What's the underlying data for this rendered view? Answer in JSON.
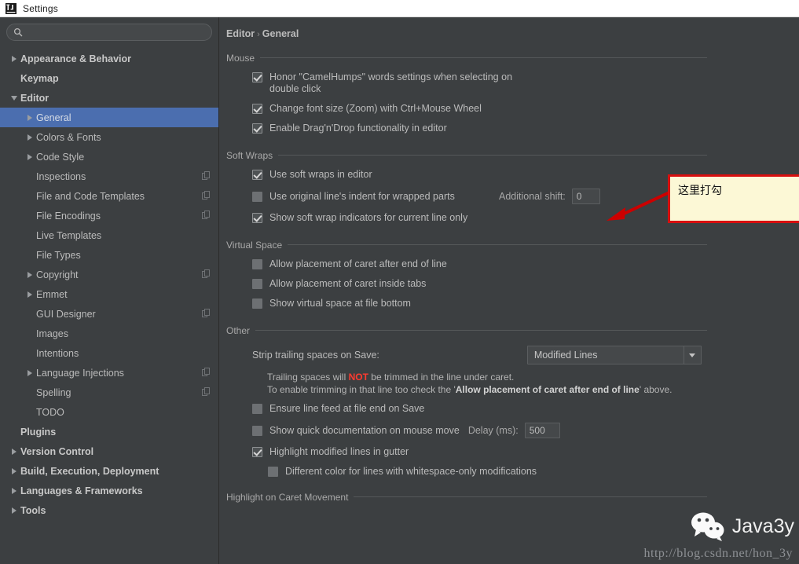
{
  "window": {
    "title": "Settings",
    "icon": "intellij-idea-icon"
  },
  "sidebar": {
    "search": {
      "value": "",
      "placeholder": "",
      "icon": "search-icon"
    },
    "items": [
      {
        "label": "Appearance & Behavior",
        "indent": 0,
        "twisty": "right",
        "bold": true,
        "copy": false,
        "selected": false
      },
      {
        "label": "Keymap",
        "indent": 0,
        "twisty": "none",
        "bold": true,
        "copy": false,
        "selected": false
      },
      {
        "label": "Editor",
        "indent": 0,
        "twisty": "down",
        "bold": true,
        "copy": false,
        "selected": false
      },
      {
        "label": "General",
        "indent": 1,
        "twisty": "right",
        "bold": false,
        "copy": false,
        "selected": true
      },
      {
        "label": "Colors & Fonts",
        "indent": 1,
        "twisty": "right",
        "bold": false,
        "copy": false,
        "selected": false
      },
      {
        "label": "Code Style",
        "indent": 1,
        "twisty": "right",
        "bold": false,
        "copy": false,
        "selected": false
      },
      {
        "label": "Inspections",
        "indent": 1,
        "twisty": "none",
        "bold": false,
        "copy": true,
        "selected": false
      },
      {
        "label": "File and Code Templates",
        "indent": 1,
        "twisty": "none",
        "bold": false,
        "copy": true,
        "selected": false
      },
      {
        "label": "File Encodings",
        "indent": 1,
        "twisty": "none",
        "bold": false,
        "copy": true,
        "selected": false
      },
      {
        "label": "Live Templates",
        "indent": 1,
        "twisty": "none",
        "bold": false,
        "copy": false,
        "selected": false
      },
      {
        "label": "File Types",
        "indent": 1,
        "twisty": "none",
        "bold": false,
        "copy": false,
        "selected": false
      },
      {
        "label": "Copyright",
        "indent": 1,
        "twisty": "right",
        "bold": false,
        "copy": true,
        "selected": false
      },
      {
        "label": "Emmet",
        "indent": 1,
        "twisty": "right",
        "bold": false,
        "copy": false,
        "selected": false
      },
      {
        "label": "GUI Designer",
        "indent": 1,
        "twisty": "none",
        "bold": false,
        "copy": true,
        "selected": false
      },
      {
        "label": "Images",
        "indent": 1,
        "twisty": "none",
        "bold": false,
        "copy": false,
        "selected": false
      },
      {
        "label": "Intentions",
        "indent": 1,
        "twisty": "none",
        "bold": false,
        "copy": false,
        "selected": false
      },
      {
        "label": "Language Injections",
        "indent": 1,
        "twisty": "right",
        "bold": false,
        "copy": true,
        "selected": false
      },
      {
        "label": "Spelling",
        "indent": 1,
        "twisty": "none",
        "bold": false,
        "copy": true,
        "selected": false
      },
      {
        "label": "TODO",
        "indent": 1,
        "twisty": "none",
        "bold": false,
        "copy": false,
        "selected": false
      },
      {
        "label": "Plugins",
        "indent": 0,
        "twisty": "none",
        "bold": true,
        "copy": false,
        "selected": false
      },
      {
        "label": "Version Control",
        "indent": 0,
        "twisty": "right",
        "bold": true,
        "copy": false,
        "selected": false
      },
      {
        "label": "Build, Execution, Deployment",
        "indent": 0,
        "twisty": "right",
        "bold": true,
        "copy": false,
        "selected": false
      },
      {
        "label": "Languages & Frameworks",
        "indent": 0,
        "twisty": "right",
        "bold": true,
        "copy": false,
        "selected": false
      },
      {
        "label": "Tools",
        "indent": 0,
        "twisty": "right",
        "bold": true,
        "copy": false,
        "selected": false
      }
    ]
  },
  "breadcrumb": {
    "parent": "Editor",
    "separator": "›",
    "current": "General"
  },
  "sections": {
    "mouse": {
      "title": "Mouse",
      "options": [
        {
          "label": "Honor \"CamelHumps\" words settings when selecting on double click",
          "checked": true
        },
        {
          "label": "Change font size (Zoom) with Ctrl+Mouse Wheel",
          "checked": true
        },
        {
          "label": "Enable Drag'n'Drop functionality in editor",
          "checked": true
        }
      ]
    },
    "soft_wraps": {
      "title": "Soft Wraps",
      "options": [
        {
          "label": "Use soft wraps in editor",
          "checked": true
        },
        {
          "label": "Use original line's indent for wrapped parts",
          "checked": false
        },
        {
          "label": "Show soft wrap indicators for current line only",
          "checked": true
        }
      ],
      "additional_shift_label": "Additional shift:",
      "additional_shift_value": "0"
    },
    "virtual_space": {
      "title": "Virtual Space",
      "options": [
        {
          "label": "Allow placement of caret after end of line",
          "checked": false
        },
        {
          "label": "Allow placement of caret inside tabs",
          "checked": false
        },
        {
          "label": "Show virtual space at file bottom",
          "checked": false
        }
      ]
    },
    "other": {
      "title": "Other",
      "strip_label": "Strip trailing spaces on Save:",
      "strip_value": "Modified Lines",
      "note_line1_a": "Trailing spaces will ",
      "note_line1_red": "NOT",
      "note_line1_b": " be trimmed in the line under caret.",
      "note_line2_a": "To enable trimming in that line too check the '",
      "note_line2_strong": "Allow placement of caret after end of line",
      "note_line2_b": "' above.",
      "ensure_lf_label": "Ensure line feed at file end on Save",
      "ensure_lf_checked": false,
      "quick_doc_label": "Show quick documentation on mouse move",
      "quick_doc_checked": false,
      "delay_label": "Delay (ms):",
      "delay_value": "500",
      "highlight_modified_label": "Highlight modified lines in gutter",
      "highlight_modified_checked": true,
      "different_color_label": "Different color for lines with whitespace-only modifications",
      "different_color_checked": false
    },
    "highlight_caret": {
      "title": "Highlight on Caret Movement"
    }
  },
  "annotation": {
    "text": "这里打勾",
    "box_color": "#fcf8d6",
    "border_color": "#d80f0f",
    "arrow_color": "#cc0000"
  },
  "watermark": {
    "name": "Java3y",
    "url": "http://blog.csdn.net/hon_3y",
    "logo": "wechat-icon"
  }
}
